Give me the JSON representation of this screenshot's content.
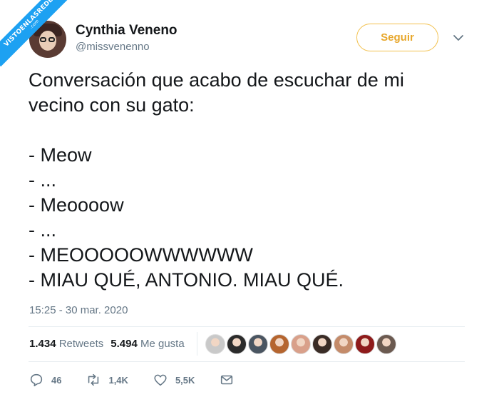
{
  "watermark": {
    "text": "VISTOENLASREDES",
    "sub": ".com"
  },
  "user": {
    "name": "Cynthia Veneno",
    "handle": "@missvenenno"
  },
  "follow_button": "Seguir",
  "tweet": {
    "lines": [
      "Conversación que acabo de escuchar de mi",
      "vecino con su gato:",
      "",
      "- Meow",
      "- ...",
      "- Meoooow",
      "- ...",
      "- MEOOOOOWWWWWW",
      "- MIAU QUÉ, ANTONIO. MIAU QUÉ."
    ],
    "timestamp": "15:25 - 30 mar. 2020"
  },
  "stats": {
    "retweets_count": "1.434",
    "retweets_label": "Retweets",
    "likes_count": "5.494",
    "likes_label": "Me gusta"
  },
  "likers": [
    {
      "color": "#c9c9c9"
    },
    {
      "color": "#2b2b2b"
    },
    {
      "color": "#4a5561"
    },
    {
      "color": "#b5652f"
    },
    {
      "color": "#d9a08a"
    },
    {
      "color": "#3a2c26"
    },
    {
      "color": "#c48b6a"
    },
    {
      "color": "#8e1b1b"
    },
    {
      "color": "#6b5a50"
    }
  ],
  "actions": {
    "reply_count": "46",
    "retweet_count": "1,4K",
    "like_count": "5,5K"
  }
}
